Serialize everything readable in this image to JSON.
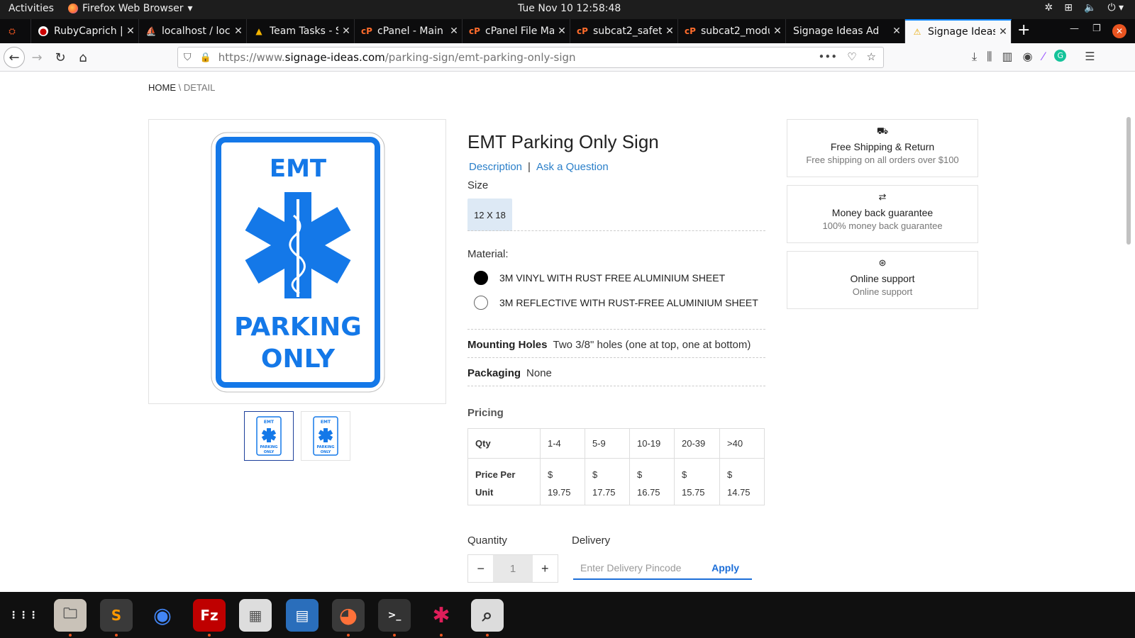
{
  "topbar": {
    "activities": "Activities",
    "app_name": "Firefox Web Browser",
    "clock": "Tue Nov 10  12:58:48"
  },
  "tabs": [
    {
      "label": "RubyCaprich |",
      "icon": "ruby-icon"
    },
    {
      "label": "localhost / loc",
      "icon": "phpmyadmin-icon"
    },
    {
      "label": "Team Tasks - S",
      "icon": "teamtasks-icon"
    },
    {
      "label": "cPanel - Main",
      "icon": "cpanel-icon"
    },
    {
      "label": "cPanel File Ma",
      "icon": "cpanel-icon"
    },
    {
      "label": "subcat2_safet",
      "icon": "cpanel-icon"
    },
    {
      "label": "subcat2_modu",
      "icon": "cpanel-icon"
    },
    {
      "label": "Signage Ideas Ad",
      "icon": "none"
    },
    {
      "label": "Signage Ideas",
      "icon": "warning-icon"
    }
  ],
  "navbar": {
    "url_prefix": "https://www.",
    "url_domain": "signage-ideas.com",
    "url_path": "/parking-sign/emt-parking-only-sign"
  },
  "breadcrumb": {
    "home": "HOME",
    "sep": " \\ ",
    "current": "DETAIL"
  },
  "sign": {
    "top_text": "EMT",
    "line1": "PARKING",
    "line2": "ONLY",
    "color": "#1478e8"
  },
  "product": {
    "title": "EMT Parking Only Sign",
    "link_description": "Description",
    "link_separator": "|",
    "link_question": "Ask a Question",
    "size_label": "Size",
    "size_option": "12 X 18",
    "material_label": "Material:",
    "materials": [
      {
        "label": "3M VINYL WITH RUST FREE ALUMINIUM SHEET",
        "selected": true
      },
      {
        "label": "3M REFLECTIVE WITH RUST-FREE ALUMINIUM SHEET",
        "selected": false
      }
    ],
    "mounting_label": "Mounting Holes",
    "mounting_value": "Two 3/8\" holes (one at top, one at bottom)",
    "packaging_label": "Packaging",
    "packaging_value": "None",
    "pricing_label": "Pricing"
  },
  "pricing": {
    "qty_header": "Qty",
    "price_header": "Price Per Unit",
    "tiers": [
      {
        "range": "1-4",
        "currency": "$",
        "price": "19.75"
      },
      {
        "range": "5-9",
        "currency": "$",
        "price": "17.75"
      },
      {
        "range": "10-19",
        "currency": "$",
        "price": "16.75"
      },
      {
        "range": "20-39",
        "currency": "$",
        "price": "15.75"
      },
      {
        "range": ">40",
        "currency": "$",
        "price": "14.75"
      }
    ]
  },
  "order": {
    "quantity_label": "Quantity",
    "quantity_value": "1",
    "minus": "−",
    "plus": "+",
    "delivery_label": "Delivery",
    "pincode_placeholder": "Enter Delivery Pincode",
    "apply": "Apply"
  },
  "features": [
    {
      "icon": "truck-icon",
      "glyph": "⛟",
      "title": "Free Shipping & Return",
      "sub": "Free shipping on all orders over $100"
    },
    {
      "icon": "exchange-icon",
      "glyph": "⇄",
      "title": "Money back guarantee",
      "sub": "100% money back guarantee"
    },
    {
      "icon": "lifebuoy-icon",
      "glyph": "⊛",
      "title": "Online support",
      "sub": "Online support"
    }
  ],
  "dock": [
    {
      "name": "app-grid",
      "glyph": "⋮⋮⋮",
      "color": "#101010"
    },
    {
      "name": "files",
      "glyph": "🗀",
      "color": "#c9c2b8"
    },
    {
      "name": "sublime-text",
      "glyph": "S",
      "color": "#4a4a4a"
    },
    {
      "name": "chrome",
      "glyph": "◉",
      "color": "#101010"
    },
    {
      "name": "filezilla",
      "glyph": "Fz",
      "color": "#bf0000"
    },
    {
      "name": "calculator",
      "glyph": "▦",
      "color": "#dddddd"
    },
    {
      "name": "writer",
      "glyph": "▤",
      "color": "#2a6ebb"
    },
    {
      "name": "firefox",
      "glyph": "◕",
      "color": "#3a3a3a"
    },
    {
      "name": "terminal",
      "glyph": ">_",
      "color": "#333333"
    },
    {
      "name": "slack",
      "glyph": "✱",
      "color": "#101010"
    },
    {
      "name": "image-viewer",
      "glyph": "⌕",
      "color": "#dcdcdc"
    }
  ]
}
